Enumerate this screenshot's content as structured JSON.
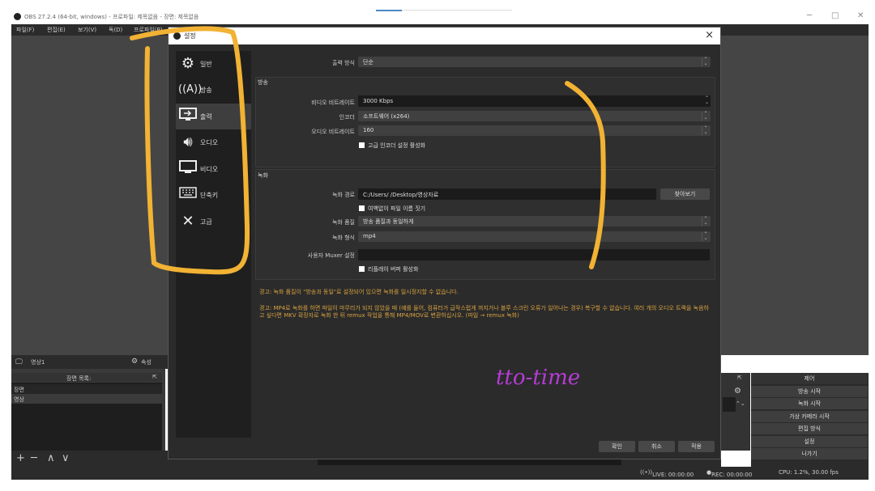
{
  "window": {
    "title": "OBS 27.2.4 (64-bit, windows) - 프로파일: 제목없음 - 장면: 제목없음",
    "minimize": "─",
    "maximize": "□",
    "close": "✕"
  },
  "menu": [
    "파일(F)",
    "편집(E)",
    "보기(V)",
    "독(D)",
    "프로파일(P)"
  ],
  "scene_dock": {
    "tab_scene": "영상1",
    "tab_props": "속성",
    "header": "장면 목록:",
    "items": [
      "장면",
      "영상"
    ],
    "toolbar": [
      "+",
      "─",
      "∧",
      "∨"
    ]
  },
  "controls": {
    "header": "제어",
    "buttons": [
      "방송 시작",
      "녹화 시작",
      "가상 카메라 시작",
      "편집 방식",
      "설정",
      "나가기"
    ]
  },
  "status_bar": {
    "live": "LIVE: 00:00:00",
    "rec": "REC: 00:00:00",
    "cpu": "CPU: 1.2%, 30.00 fps"
  },
  "dialog": {
    "title": "설정",
    "close": "×",
    "sidebar": [
      {
        "icon": "gear-icon",
        "label": "일반"
      },
      {
        "icon": "broadcast-icon",
        "label": "방송"
      },
      {
        "icon": "output-icon",
        "label": "출력",
        "selected": true
      },
      {
        "icon": "speaker-icon",
        "label": "오디오"
      },
      {
        "icon": "monitor-icon",
        "label": "비디오"
      },
      {
        "icon": "keyboard-icon",
        "label": "단축키"
      },
      {
        "icon": "tools-icon",
        "label": "고급"
      }
    ],
    "output_mode_label": "출력 방식",
    "output_mode_value": "단순",
    "streaming": {
      "title": "방송",
      "video_bitrate_label": "비디오 비트레이트",
      "video_bitrate_value": "3000 Kbps",
      "encoder_label": "인코더",
      "encoder_value": "소프트웨어 (x264)",
      "audio_bitrate_label": "오디오 비트레이트",
      "audio_bitrate_value": "160",
      "advanced_encoder": "고급 인코더 설정 활성화"
    },
    "recording": {
      "title": "녹화",
      "path_label": "녹화 경로",
      "path_value": "C:/Users/  /Desktop/영상자료",
      "browse": "찾아보기",
      "no_space": "여백없이 파일 이름 짓기",
      "quality_label": "녹화 품질",
      "quality_value": "방송 품질과 동일하게",
      "format_label": "녹화 형식",
      "format_value": "mp4",
      "muxer_label": "사용자 Muxer 설정",
      "muxer_value": "",
      "replay_buffer": "리플레이 버퍼 활성화"
    },
    "warning1": "경고: 녹화 품질이 \"방송과 동일\"로 설정되어 있으면 녹화를 일시정지할 수 없습니다.",
    "warning2": "경고: MP4로 녹화를 하면 파일이 마무리가 되지 않았을 때 (예를 들어, 컴퓨터가 급작스럽게 꺼지거나 블루 스크린 오류가 일어나는 경우) 복구할 수 없습니다. 여러 개의 오디오 트랙을 녹음하고 싶다면 MKV 확장자로 녹화 한 뒤 remux 작업을 통해 MP4/MOV로 변환하십시오. (파일 → remux 녹화)",
    "buttons": {
      "ok": "확인",
      "cancel": "취소",
      "apply": "적용"
    }
  },
  "annotation": {
    "handwritten": "tto-time",
    "highlight_color": "#f2b233",
    "text_color": "#b63cd6"
  }
}
